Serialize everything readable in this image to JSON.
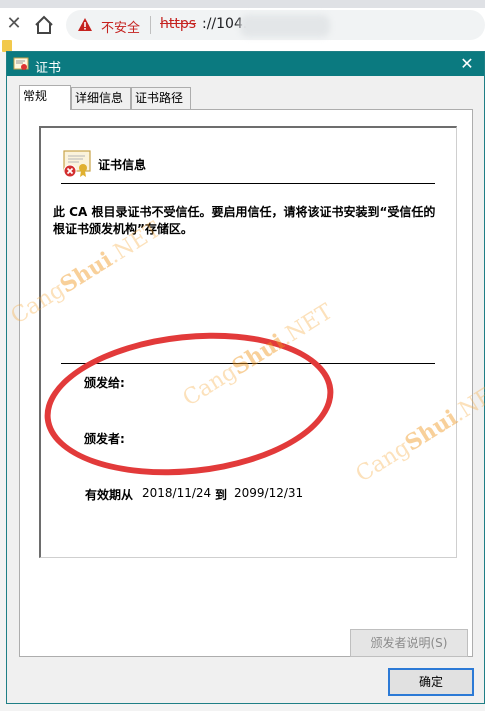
{
  "browser": {
    "close_glyph": "✕",
    "security_warning": "不安全",
    "url_scheme": "https",
    "url_host_visible": "://104.",
    "colors": {
      "warning": "#c5221f"
    }
  },
  "dialog": {
    "title": "证书",
    "close_glyph": "✕",
    "tabs": [
      {
        "label": "常规",
        "active": true
      },
      {
        "label": "详细信息",
        "active": false
      },
      {
        "label": "证书路径",
        "active": false
      }
    ],
    "general": {
      "info_title": "证书信息",
      "warning_message": "此 CA 根目录证书不受信任。要启用信任，请将该证书安装到“受信任的根证书颁发机构”存储区。",
      "issued_to_label": "颁发给:",
      "issued_by_label": "颁发者:",
      "valid_from_label": "有效期从",
      "valid_from": "2018/11/24",
      "valid_to_word": "到",
      "valid_to": "2099/12/31"
    },
    "issuer_statement_button": "颁发者说明(S)",
    "ok_button": "确定",
    "colors": {
      "titlebar": "#0b7a80",
      "annotation": "#e23a3a"
    }
  },
  "watermark": {
    "prefix": "Cang",
    "middle": "Shui",
    "suffix": ".NET"
  }
}
